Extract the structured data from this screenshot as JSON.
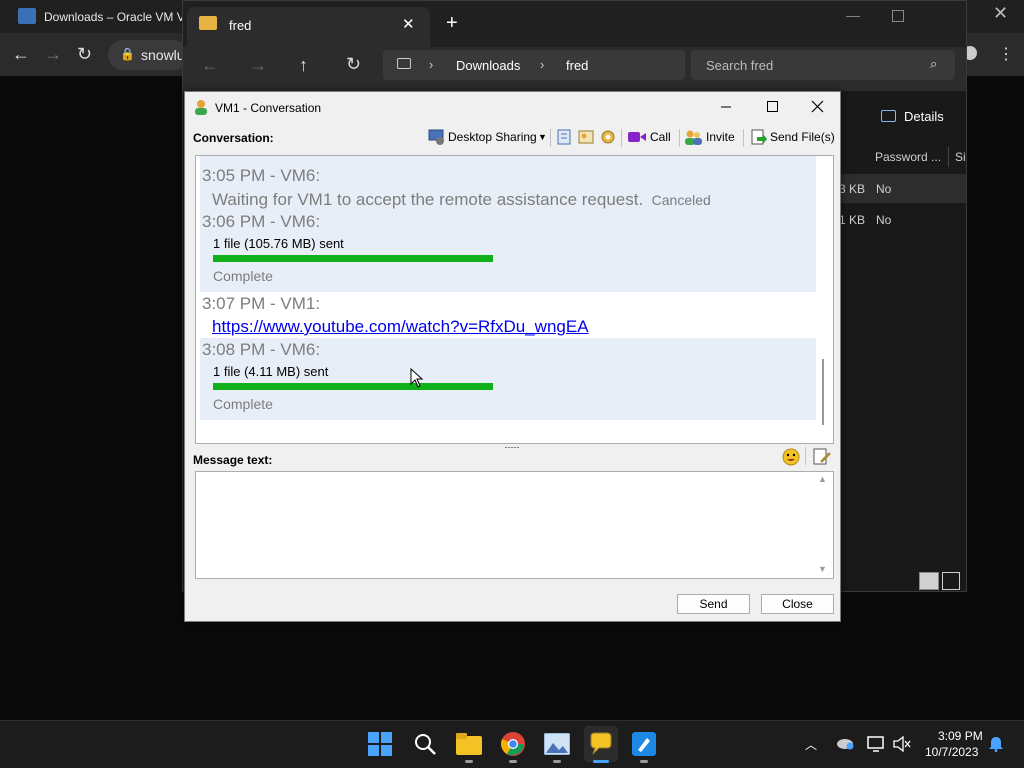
{
  "browser": {
    "tab_title": "Downloads – Oracle VM V",
    "url_text": "snowlu"
  },
  "explorer": {
    "tab_title": "fred",
    "breadcrumb": [
      "Downloads",
      "fred"
    ],
    "search_placeholder": "Search fred",
    "details_label": "Details",
    "columns": [
      "Password ...",
      "Si"
    ],
    "rows": [
      {
        "size": "3 KB",
        "password": "No"
      },
      {
        "size": "1 KB",
        "password": "No"
      }
    ]
  },
  "dialog": {
    "title": "VM1 - Conversation",
    "conversation_label": "Conversation:",
    "toolbar": {
      "desktop_sharing": "Desktop Sharing",
      "call": "Call",
      "invite": "Invite",
      "send_files": "Send File(s)"
    },
    "messages": [
      {
        "header": "3:05 PM - VM6:",
        "text": "Waiting for VM1 to accept the remote assistance request.",
        "status": "Canceled"
      },
      {
        "header": "3:06 PM - VM6:",
        "text": "1 file (105.76 MB) sent",
        "progress": 1.0,
        "status": "Complete"
      },
      {
        "header": "3:07 PM - VM1:",
        "link": "https://www.youtube.com/watch?v=RfxDu_wngEA"
      },
      {
        "header": "3:08 PM - VM6:",
        "text": "1 file (4.11 MB) sent",
        "progress": 1.0,
        "status": "Complete"
      }
    ],
    "message_label": "Message text:",
    "message_value": "",
    "send_label": "Send",
    "close_label": "Close"
  },
  "taskbar": {
    "time": "3:09 PM",
    "date": "10/7/2023",
    "pinned": [
      "windows-start-icon",
      "search-icon",
      "file-explorer-icon",
      "chrome-icon",
      "photos-icon",
      "chat-app-icon",
      "paint-icon"
    ]
  },
  "colors": {
    "progress": "#11b11b",
    "link": "#0000ee",
    "message_bg": "#e8eef8",
    "accent": "#4aa3ff"
  }
}
